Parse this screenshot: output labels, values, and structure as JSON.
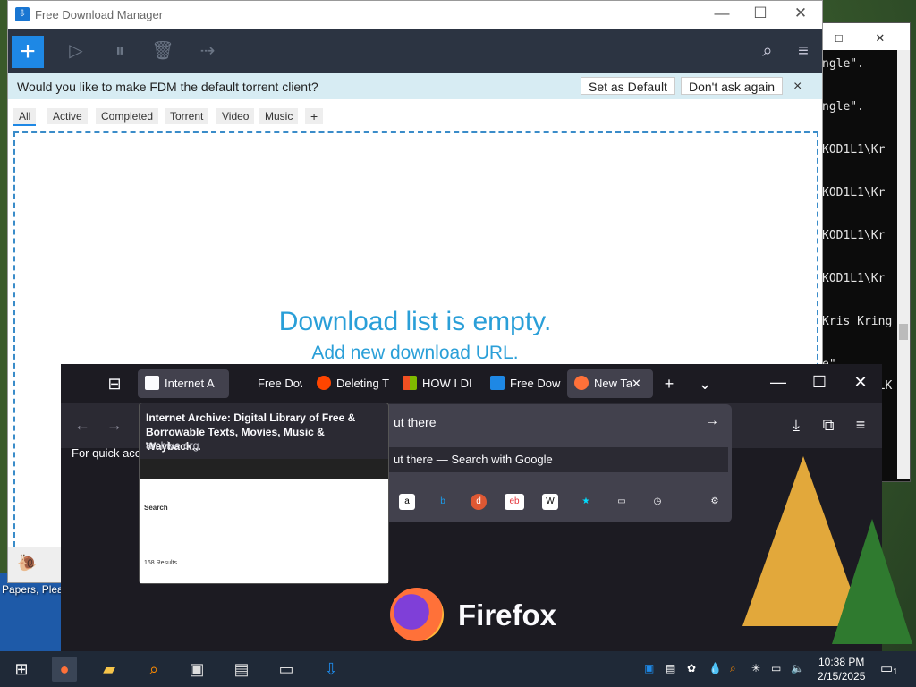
{
  "desktop": {
    "icon_label": "Papers, Plea"
  },
  "terminal": {
    "lines": [
      "ngle\".",
      "",
      "ngle\".",
      "",
      "KOD1L1\\Kr",
      "",
      "KOD1L1\\Kr",
      "",
      "KOD1L1\\Kr",
      "",
      "KOD1L1\\Kr",
      "",
      "Kris Kring",
      "",
      "e\".",
      "DESKTOP-LK",
      "",
      "D"
    ]
  },
  "fdm": {
    "title": "Free Download Manager",
    "notice": {
      "question": "Would you like to make FDM the default torrent client?",
      "set_default": "Set as Default",
      "dont_ask": "Don't ask again",
      "close": "×"
    },
    "filters": [
      "All",
      "Active",
      "Completed",
      "Torrent",
      "Video",
      "Music"
    ],
    "add_filter": "+",
    "empty_title": "Download list is empty.",
    "empty_sub": "Add new download URL."
  },
  "firefox": {
    "tabs": [
      {
        "label": "Internet A",
        "icon": "archive-icon",
        "color": "#fbfbfe"
      },
      {
        "label": "Free Dow",
        "icon": "fdm-icon",
        "color": "#1c1b22"
      },
      {
        "label": "Deleting T",
        "icon": "reddit-icon",
        "color": "#ff4500"
      },
      {
        "label": "HOW I DI",
        "icon": "windows-icon",
        "color": "#f25022"
      },
      {
        "label": "Free Dow",
        "icon": "fdm-icon",
        "color": "#1e88e5"
      },
      {
        "label": "New Ta",
        "icon": "firefox-icon",
        "color": "#ff7139"
      }
    ],
    "url_text": "ut there",
    "suggestion": "ut there",
    "suggestion_suffix": "— Search with Google",
    "quick_access": "For quick acce",
    "brand": "Firefox",
    "shortcuts": [
      "amazon",
      "bing",
      "duckduckgo",
      "ebay",
      "wikipedia",
      "bookmarks",
      "tabs",
      "history"
    ],
    "preview": {
      "title": "Internet Archive: Digital Library of Free & Borrowable Texts, Movies, Music & Wayback...",
      "url": "archive.org",
      "search_label": "Search",
      "results_label": "168 Results"
    }
  },
  "taskbar": {
    "time": "10:38 PM",
    "date": "2/15/2025",
    "notification_count": "1"
  }
}
